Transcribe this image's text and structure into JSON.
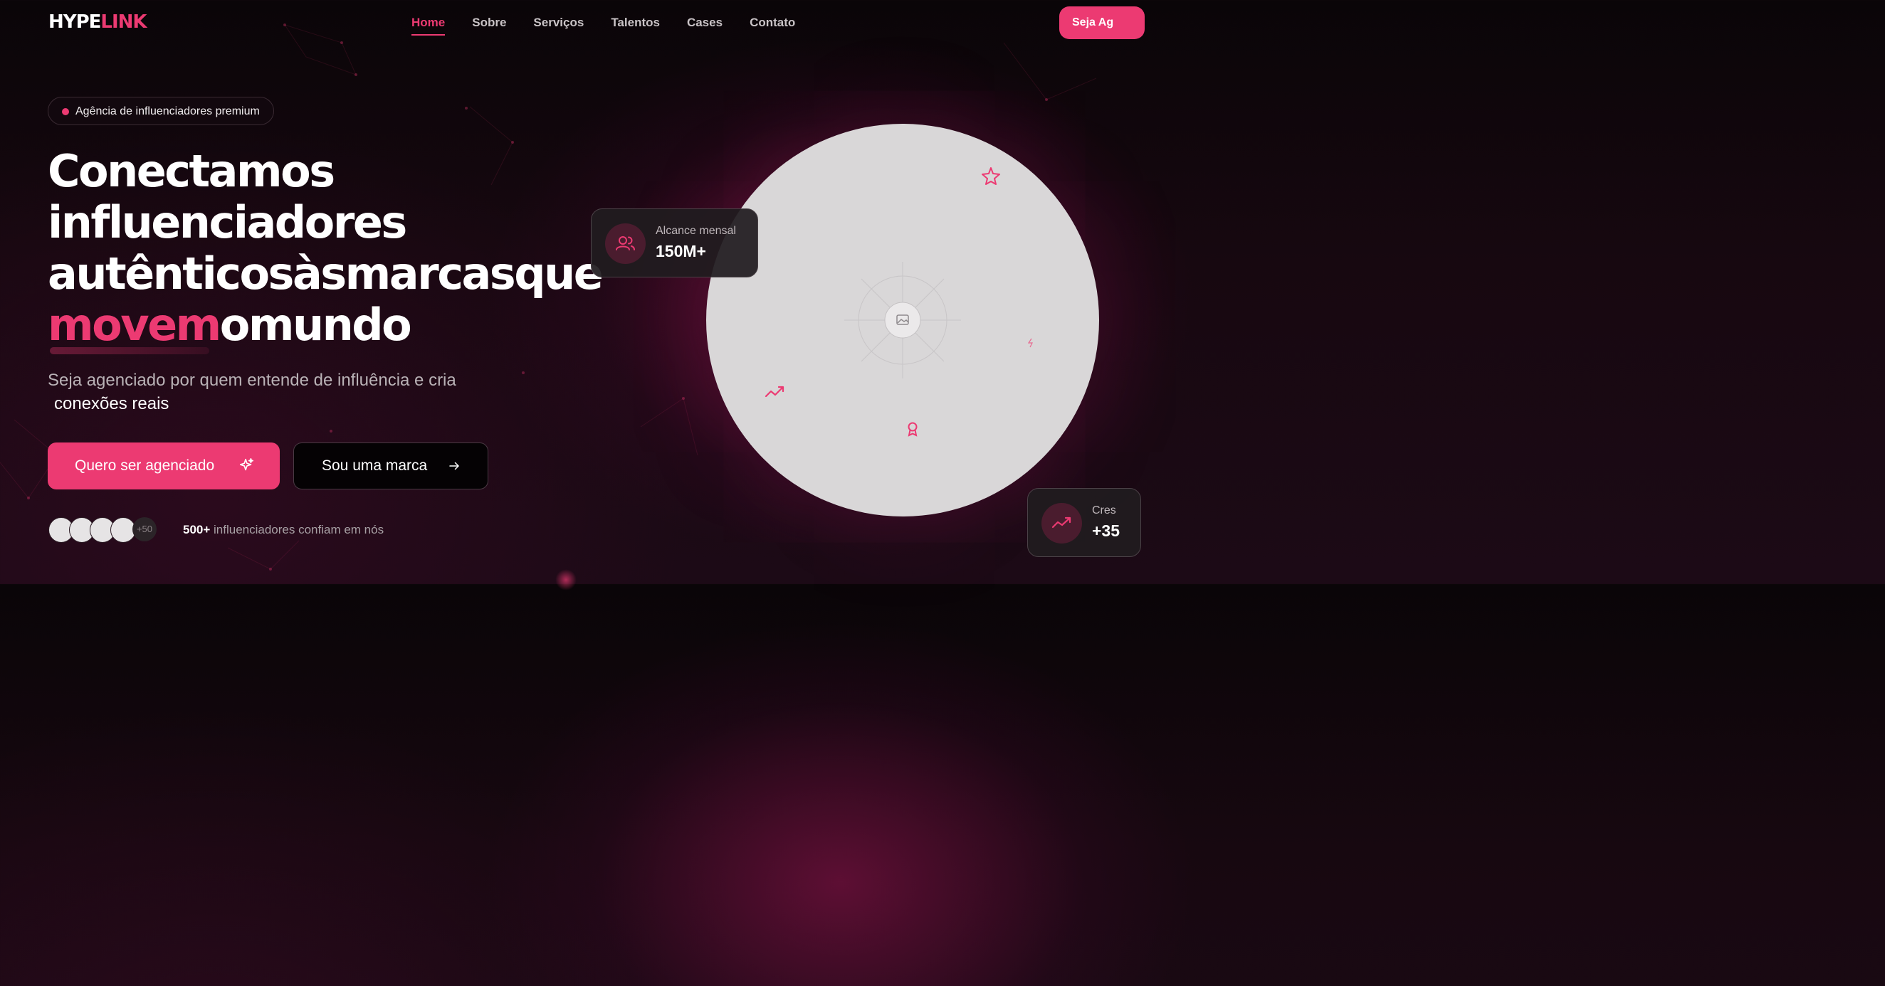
{
  "brand": {
    "logo_part1": "HYPE",
    "logo_part2": "LINK",
    "accent_color": "#ec3a72"
  },
  "nav": {
    "items": [
      {
        "label": "Home",
        "active": true
      },
      {
        "label": "Sobre"
      },
      {
        "label": "Serviços"
      },
      {
        "label": "Talentos"
      },
      {
        "label": "Cases"
      },
      {
        "label": "Contato"
      }
    ],
    "cta_label": "Seja Ag"
  },
  "hero": {
    "badge": "Agência de influenciadores premium",
    "headline_line1": "Conectamos",
    "headline_line2": "influenciadores",
    "headline_line3": "autênticosàsmarcasque",
    "headline_highlight": "movem",
    "headline_end": "omundo",
    "subtitle": "Seja agenciado por quem entende de influência e cria",
    "subtitle_strong": "conexões reais",
    "primary_button": "Quero ser agenciado",
    "secondary_button": "Sou uma marca",
    "avatars_more": "+50",
    "trust_strong": "500+",
    "trust_text": " influenciadores confiam em nós"
  },
  "stats": {
    "card1": {
      "label": "Alcance mensal",
      "value": "150M+",
      "icon": "users-icon"
    },
    "card2": {
      "label": "Cres",
      "value": "+35",
      "icon": "trending-up-icon"
    }
  },
  "visual": {
    "image_placeholder_icon": "image-icon",
    "float_icons": [
      "star-icon",
      "trending-up-icon",
      "award-icon",
      "zap-icon"
    ]
  }
}
